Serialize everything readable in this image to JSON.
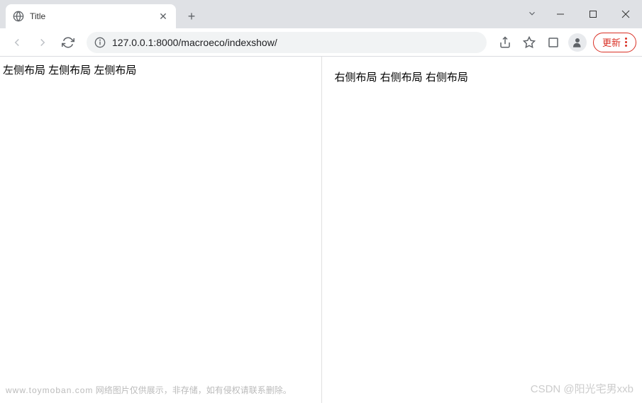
{
  "tab": {
    "title": "Title"
  },
  "address": {
    "url": "127.0.0.1:8000/macroeco/indexshow/"
  },
  "toolbar": {
    "update_label": "更新"
  },
  "content": {
    "left_text": "左侧布局 左侧布局 左侧布局",
    "right_text": "右侧布局 右侧布局 右侧布局"
  },
  "watermark": {
    "left_domain": "www.toymoban.com",
    "left_text": "网络图片仅供展示，非存储，如有侵权请联系删除。",
    "right": "CSDN @阳光宅男xxb"
  }
}
